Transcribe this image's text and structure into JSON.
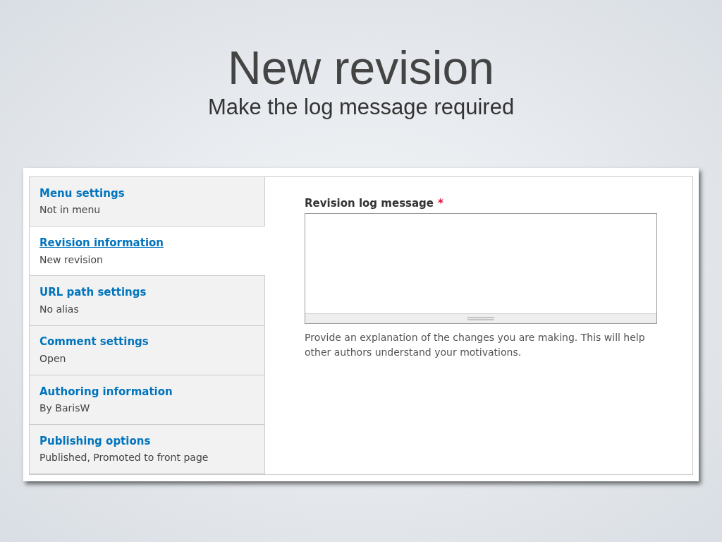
{
  "slide": {
    "title": "New revision",
    "subtitle": "Make the log message required"
  },
  "sidebar": {
    "items": [
      {
        "title": "Menu settings",
        "summary": "Not in menu",
        "selected": false
      },
      {
        "title": "Revision information",
        "summary": "New revision",
        "selected": true
      },
      {
        "title": "URL path settings",
        "summary": "No alias",
        "selected": false
      },
      {
        "title": "Comment settings",
        "summary": "Open",
        "selected": false
      },
      {
        "title": "Authoring information",
        "summary": "By BarisW",
        "selected": false
      },
      {
        "title": "Publishing options",
        "summary": "Published, Promoted to front page",
        "selected": false
      }
    ]
  },
  "field": {
    "label": "Revision log message",
    "required_mark": "*",
    "description": "Provide an explanation of the changes you are making. This will help other authors understand your motivations."
  }
}
